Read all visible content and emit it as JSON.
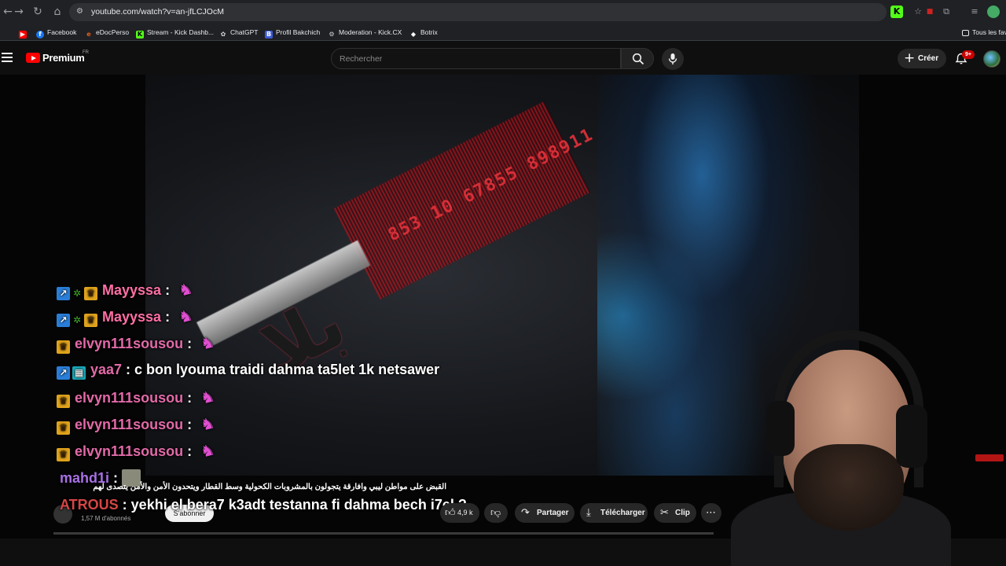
{
  "browser": {
    "url": "youtube.com/watch?v=an-jfLCJOcM",
    "bookmarks": [
      {
        "label": "",
        "icon": "youtube-icon",
        "color": "#ff0000"
      },
      {
        "label": "Facebook",
        "icon": "facebook-icon",
        "color": "#1877f2"
      },
      {
        "label": "eDocPerso",
        "icon": "edocperso-icon",
        "color": "#e85d1a"
      },
      {
        "label": "Stream - Kick Dashb...",
        "icon": "kick-icon",
        "color": "#53fc18"
      },
      {
        "label": "ChatGPT",
        "icon": "chatgpt-icon",
        "color": "#cfcfcf"
      },
      {
        "label": "Profil Bakchich",
        "icon": "bakchich-icon",
        "color": "#3b5bdb"
      },
      {
        "label": "Moderation - Kick.CX",
        "icon": "moderation-icon",
        "color": "#cfcfcf"
      },
      {
        "label": "Botrix",
        "icon": "botrix-icon",
        "color": "#ffffff"
      }
    ],
    "all_bookmarks": "Tous les fav"
  },
  "masthead": {
    "logo_text": "Premium",
    "region": "FR",
    "search_placeholder": "Rechercher",
    "create_label": "Créer",
    "notification_count": "9+"
  },
  "chat": [
    {
      "badges": [
        "blue",
        "leaf",
        "crown"
      ],
      "user": "Mayyssa",
      "user_color": "#ff6fa5",
      "message": "",
      "emote": true
    },
    {
      "badges": [
        "blue",
        "leaf",
        "crown"
      ],
      "user": "Mayyssa",
      "user_color": "#ff6fa5",
      "message": "",
      "emote": true
    },
    {
      "badges": [
        "crown"
      ],
      "user": "elvyn111sousou",
      "user_color": "#e26aa8",
      "message": "",
      "emote": true
    },
    {
      "badges": [
        "blue",
        "teal"
      ],
      "user": "yaa7",
      "user_color": "#e26aa8",
      "message": "c bon lyouma traidi dahma ta5let 1k netsawer",
      "emote": false
    },
    {
      "badges": [
        "crown"
      ],
      "user": "elvyn111sousou",
      "user_color": "#e26aa8",
      "message": "",
      "emote": true
    },
    {
      "badges": [
        "crown"
      ],
      "user": "elvyn111sousou",
      "user_color": "#e26aa8",
      "message": "",
      "emote": true
    },
    {
      "badges": [
        "crown"
      ],
      "user": "elvyn111sousou",
      "user_color": "#e26aa8",
      "message": "",
      "emote": true
    },
    {
      "badges": [],
      "user": "mahd1i",
      "user_color": "#a870e6",
      "message": "",
      "emote": false
    },
    {
      "badges": [],
      "user": "ATROUS",
      "user_color": "#d64545",
      "message": "yekhi el bera7 k3adt testanna fi dahma bech i7el ?",
      "emote": false
    }
  ],
  "video": {
    "arabic_title": "القبض على مواطن ليبي وافارقة يتجولون بالمشروبات الكحولية وسط القطار ويتحدون الأمن والأمن يتصدى لهم",
    "red_numbers": "853 10 67855 898911",
    "subscribers": "1,57 M d'abonnés",
    "subscribe_label": "S'abonner",
    "like_count": "4,9 k",
    "share_label": "Partager",
    "download_label": "Télécharger",
    "clip_label": "Clip"
  }
}
